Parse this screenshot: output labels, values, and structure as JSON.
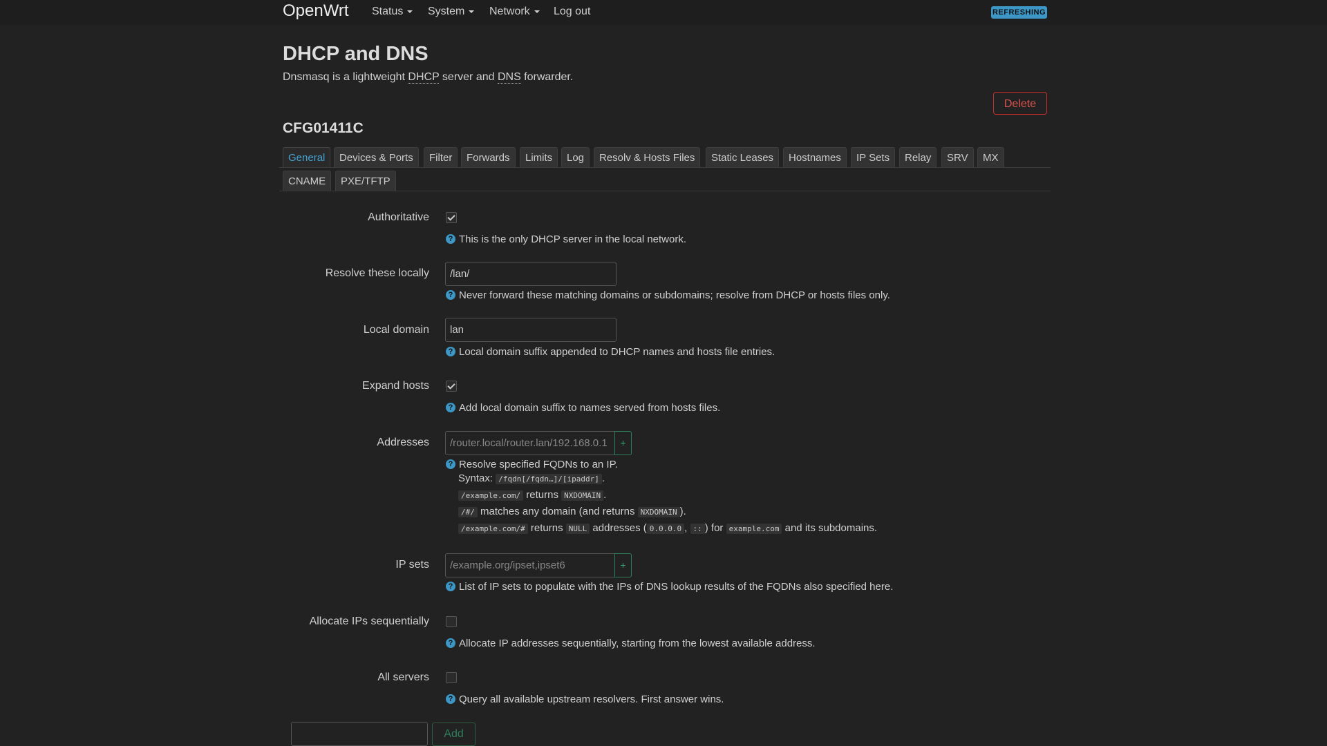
{
  "navbar": {
    "brand": "OpenWrt",
    "menu": [
      {
        "label": "Status",
        "dropdown": true
      },
      {
        "label": "System",
        "dropdown": true
      },
      {
        "label": "Network",
        "dropdown": true
      },
      {
        "label": "Log out",
        "dropdown": false
      }
    ],
    "badge": "REFRESHING"
  },
  "page": {
    "title": "DHCP and DNS",
    "description_parts": [
      "Dnsmasq is a lightweight ",
      "DHCP",
      " server and ",
      "DNS",
      " forwarder."
    ]
  },
  "actions": {
    "delete_label": "Delete"
  },
  "section": {
    "name": "CFG01411C",
    "tabs_row1": [
      "General",
      "Devices & Ports",
      "Filter",
      "Forwards",
      "Limits",
      "Log",
      "Resolv & Hosts Files",
      "Static Leases",
      "Hostnames",
      "IP Sets",
      "Relay",
      "SRV",
      "MX"
    ],
    "tabs_row2": [
      "CNAME",
      "PXE/TFTP"
    ],
    "active_tab": "General"
  },
  "fields": {
    "authoritative": {
      "label": "Authoritative",
      "checked": true,
      "help": "This is the only DHCP server in the local network."
    },
    "resolve_locally": {
      "label": "Resolve these locally",
      "value": "/lan/",
      "help": "Never forward these matching domains or subdomains; resolve from DHCP or hosts files only."
    },
    "local_domain": {
      "label": "Local domain",
      "value": "lan",
      "help": "Local domain suffix appended to DHCP names and hosts file entries."
    },
    "expand_hosts": {
      "label": "Expand hosts",
      "checked": true,
      "help": "Add local domain suffix to names served from hosts files."
    },
    "addresses": {
      "label": "Addresses",
      "placeholder": "/router.local/router.lan/192.168.0.1",
      "help": "Resolve specified FQDNs to an IP.",
      "syntax_label": "Syntax:",
      "syntax_code": "/fqdn[/fqdn…]/[ipaddr]",
      "ex1_code": "/example.com/",
      "ex1_text": "returns",
      "ex1_result": "NXDOMAIN",
      "ex2_code": "/#/",
      "ex2_text": "matches any domain (and returns",
      "ex2_result": "NXDOMAIN",
      "ex2_end": ").",
      "ex3_code": "/example.com/#",
      "ex3_text": "returns",
      "ex3_null": "NULL",
      "ex3_text2": "addresses (",
      "ex3_ip4": "0.0.0.0",
      "ex3_ip6": "::",
      "ex3_text3": ") for",
      "ex3_domain": "example.com",
      "ex3_text4": "and its subdomains."
    },
    "ip_sets": {
      "label": "IP sets",
      "placeholder": "/example.org/ipset,ipset6",
      "help": "List of IP sets to populate with the IPs of DNS lookup results of the FQDNs also specified here."
    },
    "sequential_ip": {
      "label": "Allocate IPs sequentially",
      "checked": false,
      "help": "Allocate IP addresses sequentially, starting from the lowest available address."
    },
    "all_servers": {
      "label": "All servers",
      "checked": false,
      "help": "Query all available upstream resolvers. First answer wins."
    }
  },
  "footer": {
    "add_label": "Add"
  },
  "icons": {
    "help": "help-circle-icon",
    "plus": "plus-icon",
    "check": "check-icon",
    "caret": "caret-down-icon"
  },
  "colors": {
    "accent": "#44a2d4",
    "danger": "#d9534f",
    "success": "#3aa876",
    "background": "#222222"
  }
}
